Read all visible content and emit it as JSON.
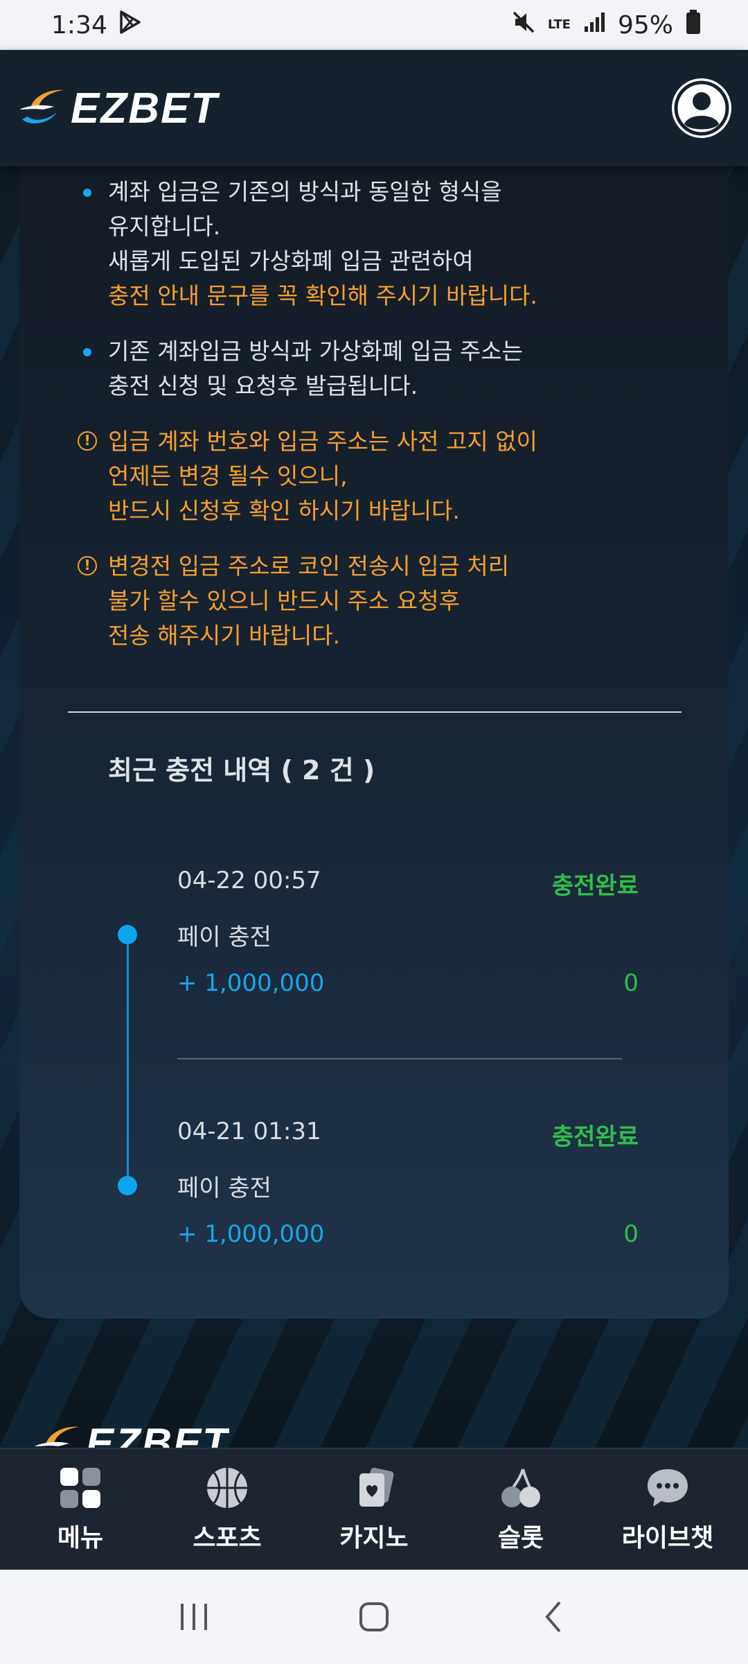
{
  "status_bar": {
    "time": "1:34",
    "network": "LTE",
    "battery": "95%"
  },
  "header": {
    "logo_text": "EZBET"
  },
  "notices": [
    {
      "type": "bullet",
      "lines": [
        {
          "text": "계좌 입금은 기존의 방식과 동일한 형식을",
          "highlight": false
        },
        {
          "text": "유지합니다.",
          "highlight": false
        },
        {
          "text": "새롭게 도입된 가상화폐 입금 관련하여",
          "highlight": false
        },
        {
          "text": "충전 안내 문구를 꼭 확인해 주시기 바랍니다.",
          "highlight": true
        }
      ]
    },
    {
      "type": "bullet",
      "lines": [
        {
          "text": "기존 계좌입금 방식과 가상화폐 입금 주소는",
          "highlight": false
        },
        {
          "text": "충전 신청 및 요청후 발급됩니다.",
          "highlight": false
        }
      ]
    },
    {
      "type": "warning",
      "lines": [
        {
          "text": "입금 계좌 번호와 입금 주소는 사전 고지 없이",
          "highlight": true
        },
        {
          "text": "언제든 변경 될수 잇으니,",
          "highlight": true
        },
        {
          "text": "반드시 신청후 확인 하시기 바랍니다.",
          "highlight": true
        }
      ]
    },
    {
      "type": "warning",
      "lines": [
        {
          "text": "변경전 입금 주소로 코인 전송시 입금 처리",
          "highlight": true
        },
        {
          "text": "불가 할수 있으니 반드시 주소 요청후",
          "highlight": true
        },
        {
          "text": "전송 해주시기 바랍니다.",
          "highlight": true
        }
      ]
    }
  ],
  "history": {
    "title": "최근 충전 내역 ( 2 건 )",
    "records": [
      {
        "date": "04-22 00:57",
        "status": "충전완료",
        "type": "페이 충전",
        "amount": "+ 1,000,000",
        "bonus": "0"
      },
      {
        "date": "04-21 01:31",
        "status": "충전완료",
        "type": "페이 충전",
        "amount": "+ 1,000,000",
        "bonus": "0"
      }
    ]
  },
  "bottom_nav": {
    "items": [
      {
        "label": "메뉴",
        "icon": "menu-grid-icon"
      },
      {
        "label": "스포츠",
        "icon": "basketball-icon"
      },
      {
        "label": "카지노",
        "icon": "playing-card-icon"
      },
      {
        "label": "슬롯",
        "icon": "cherry-icon"
      },
      {
        "label": "라이브챗",
        "icon": "chat-bubble-icon"
      }
    ]
  },
  "colors": {
    "accent_blue": "#18a7ec",
    "warning_orange": "#f6a02d",
    "success_green": "#2fbf4d"
  }
}
